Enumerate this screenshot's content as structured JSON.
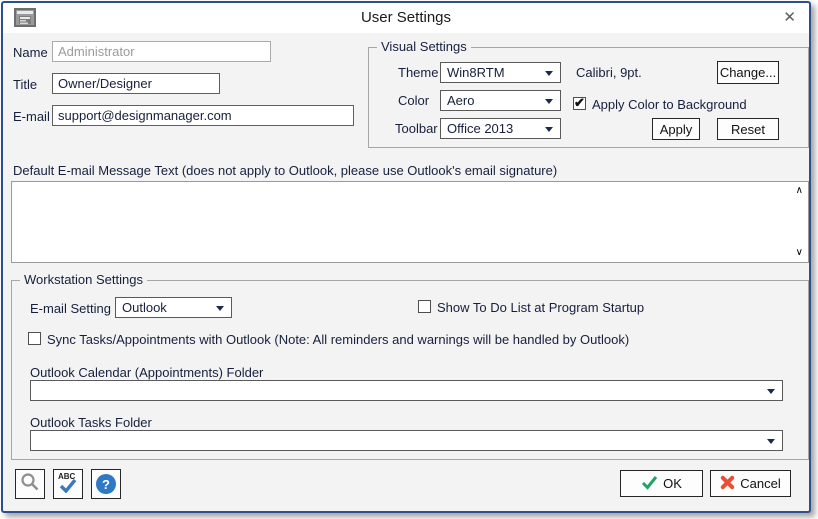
{
  "window": {
    "title": "User Settings"
  },
  "icons": {
    "close": "✕",
    "help": "?",
    "spellcheck_text": "ABC",
    "scroll_up": "∧",
    "scroll_down": "∨"
  },
  "profile": {
    "name_label": "Name",
    "name_value": "Administrator",
    "title_label": "Title",
    "title_value": "Owner/Designer",
    "email_label": "E-mail",
    "email_value": "support@designmanager.com"
  },
  "visual": {
    "legend": "Visual Settings",
    "theme_label": "Theme",
    "theme_value": "Win8RTM",
    "color_label": "Color",
    "color_value": "Aero",
    "toolbar_label": "Toolbar",
    "toolbar_value": "Office 2013",
    "font_preview": "Calibri, 9pt.",
    "change_button": "Change...",
    "apply_color_label": "Apply Color to Background",
    "apply_color_checked": true,
    "apply_button": "Apply",
    "reset_button": "Reset"
  },
  "message": {
    "label": "Default E-mail Message Text (does not apply to Outlook, please use Outlook's email signature)",
    "value": ""
  },
  "workstation": {
    "legend": "Workstation Settings",
    "email_setting_label": "E-mail Setting",
    "email_setting_value": "Outlook",
    "show_todo_label": "Show To Do List at Program Startup",
    "show_todo_checked": false,
    "sync_label": "Sync Tasks/Appointments with Outlook (Note: All reminders and warnings will be handled by Outlook)",
    "sync_checked": false,
    "calendar_folder_label": "Outlook Calendar (Appointments) Folder",
    "calendar_folder_value": "",
    "tasks_folder_label": "Outlook Tasks Folder",
    "tasks_folder_value": ""
  },
  "footer": {
    "ok": "OK",
    "cancel": "Cancel"
  },
  "colors": {
    "dialog_border": "#2e4f8f",
    "text_navy": "#16203c",
    "ok_green": "#21a366",
    "cancel_red": "#ea4f33",
    "help_blue": "#2e79c6"
  }
}
